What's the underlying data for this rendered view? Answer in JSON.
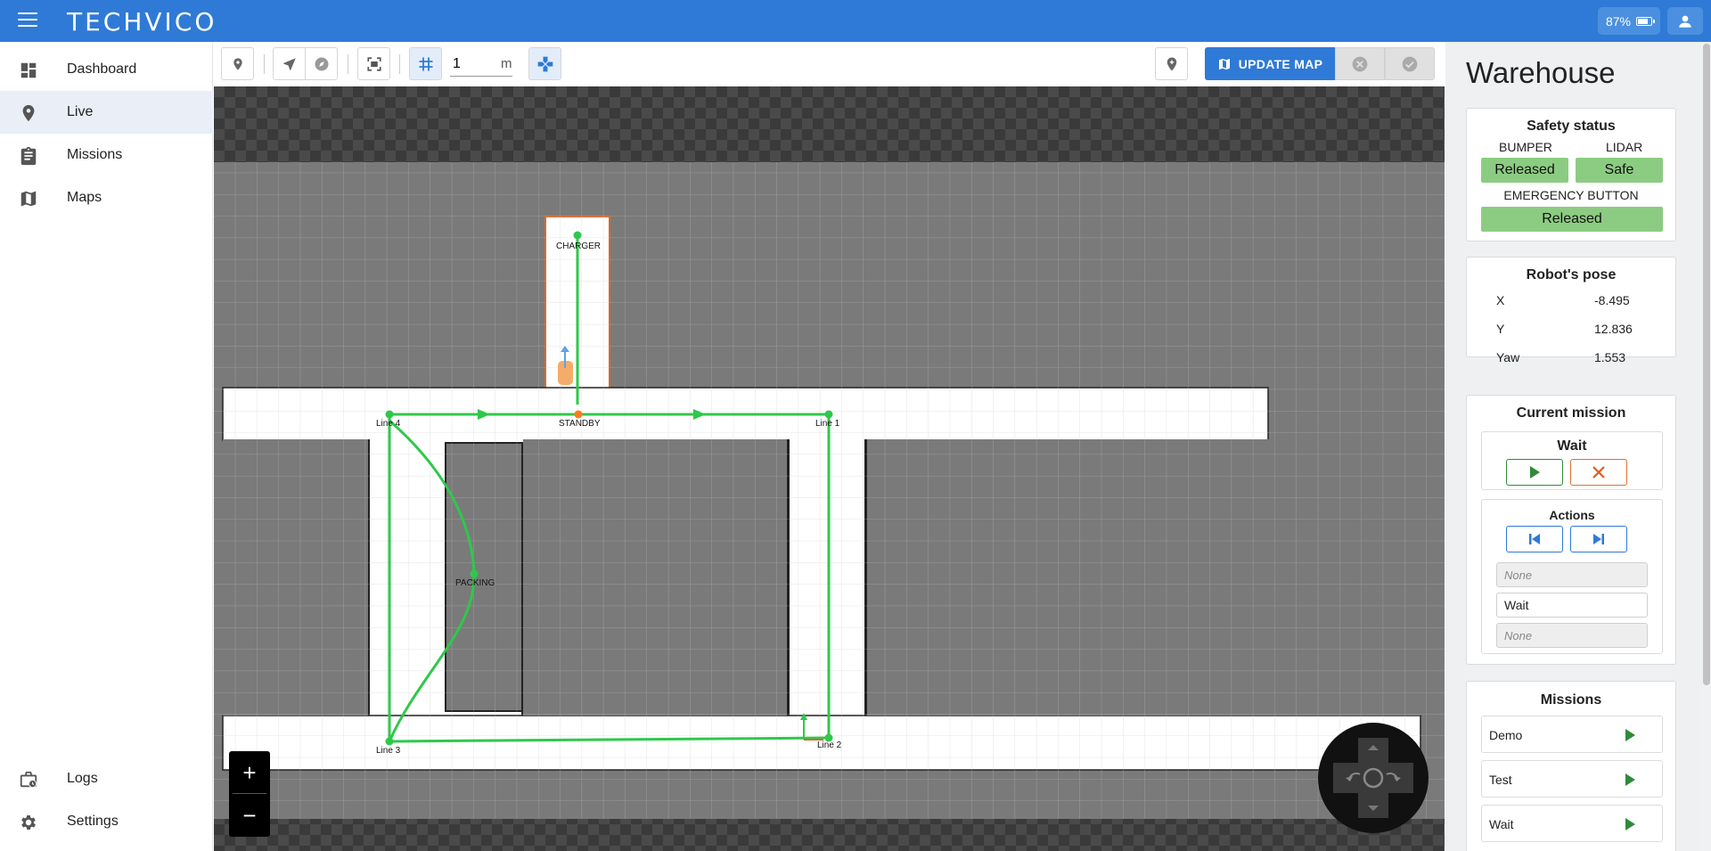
{
  "app": {
    "logo": "TECHVICO",
    "battery": "87%"
  },
  "sidebar": {
    "items": [
      {
        "label": "Dashboard",
        "icon": "dashboard-icon"
      },
      {
        "label": "Live",
        "icon": "location-pin-icon"
      },
      {
        "label": "Missions",
        "icon": "clipboard-icon"
      },
      {
        "label": "Maps",
        "icon": "map-icon"
      }
    ],
    "bottom_items": [
      {
        "label": "Logs",
        "icon": "logs-icon"
      },
      {
        "label": "Settings",
        "icon": "gear-icon"
      }
    ],
    "active": "Live"
  },
  "toolbar": {
    "grid_size": "1",
    "grid_unit": "m",
    "update_map_label": "UPDATE MAP"
  },
  "map": {
    "markers": {
      "charger": "CHARGER",
      "standby": "STANDBY",
      "line1": "Line 1",
      "line2": "Line 2",
      "line3": "Line 3",
      "line4": "Line 4",
      "packing": "PACKING"
    },
    "colors": {
      "path": "#2fc84a",
      "free_space": "#ffffff",
      "occupied": "#7a7a7a",
      "unknown": "#3d3d3d",
      "accent": "#2f7ad6",
      "status_ok": "#8ccc82",
      "standby_marker": "#ff7a1a"
    }
  },
  "panel": {
    "title": "Warehouse",
    "safety": {
      "heading": "Safety status",
      "bumper_label": "BUMPER",
      "bumper_value": "Released",
      "lidar_label": "LIDAR",
      "lidar_value": "Safe",
      "emergency_label": "EMERGENCY BUTTON",
      "emergency_value": "Released"
    },
    "pose": {
      "heading": "Robot's pose",
      "rows": [
        {
          "label": "X",
          "value": "-8.495"
        },
        {
          "label": "Y",
          "value": "12.836"
        },
        {
          "label": "Yaw",
          "value": "1.553"
        }
      ]
    },
    "current_mission": {
      "heading": "Current mission",
      "name": "Wait",
      "actions_heading": "Actions",
      "action_prev": "None",
      "action_current": "Wait",
      "action_next": "None"
    },
    "missions": {
      "heading": "Missions",
      "items": [
        "Demo",
        "Test",
        "Wait"
      ]
    }
  }
}
